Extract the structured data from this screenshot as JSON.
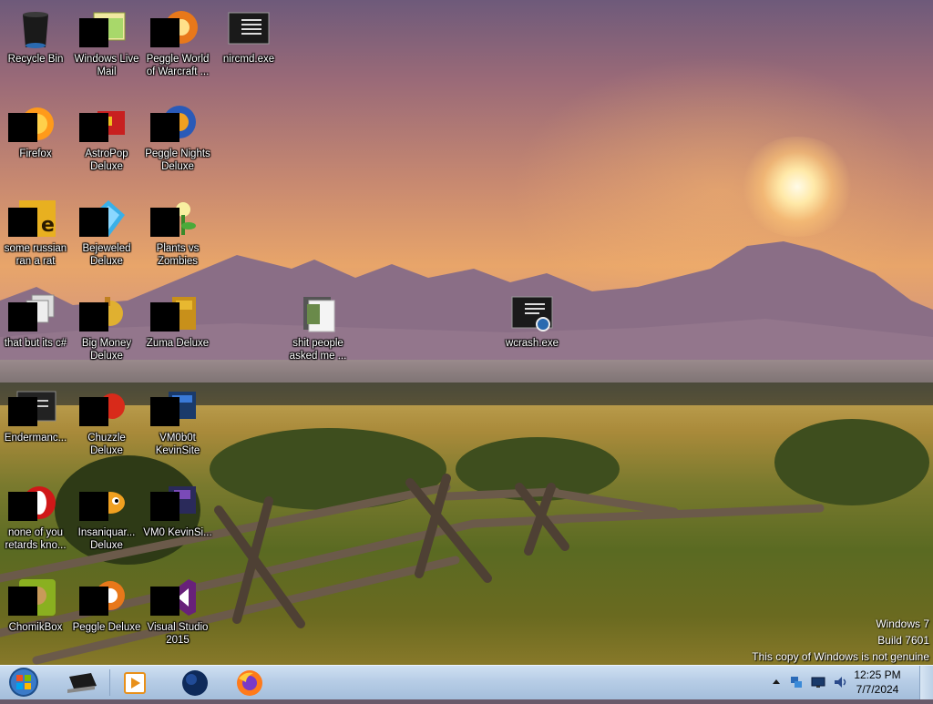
{
  "desktop": {
    "icons": [
      {
        "label": "Recycle Bin",
        "icon": "recycle-bin-icon"
      },
      {
        "label": "Windows Live Mail",
        "icon": "mail-icon"
      },
      {
        "label": "Peggle World of Warcraft ...",
        "icon": "peggle-icon"
      },
      {
        "label": "nircmd.exe",
        "icon": "console-app-icon"
      },
      {
        "label": "Firefox",
        "icon": "firefox-icon"
      },
      {
        "label": "AstroPop Deluxe",
        "icon": "astropop-icon"
      },
      {
        "label": "Peggle Nights Deluxe",
        "icon": "peggle-nights-icon"
      },
      {
        "label": "some russian ran a rat",
        "icon": "adobe-icon"
      },
      {
        "label": "Bejeweled Deluxe",
        "icon": "bejeweled-icon"
      },
      {
        "label": "Plants vs Zombies",
        "icon": "plants-vs-zombies-icon"
      },
      {
        "label": "that but its c#",
        "icon": "stacked-windows-icon"
      },
      {
        "label": "Big Money Deluxe",
        "icon": "big-money-icon"
      },
      {
        "label": "Zuma Deluxe",
        "icon": "zuma-icon"
      },
      {
        "label": "shit people asked me ...",
        "icon": "folder-icon"
      },
      {
        "label": "wcrash.exe",
        "icon": "console-search-icon"
      },
      {
        "label": "Endermanc...",
        "icon": "console-app-icon"
      },
      {
        "label": "Chuzzle Deluxe",
        "icon": "chuzzle-icon"
      },
      {
        "label": "VM0b0t KevinSite",
        "icon": "vm-icon"
      },
      {
        "label": "none of you retards kno...",
        "icon": "opera-icon"
      },
      {
        "label": "Insaniquar... Deluxe",
        "icon": "insaniquarium-icon"
      },
      {
        "label": "VM0 KevinSi...",
        "icon": "vm-icon"
      },
      {
        "label": "ChomikBox",
        "icon": "chomikbox-icon"
      },
      {
        "label": "Peggle Deluxe",
        "icon": "peggle-icon"
      },
      {
        "label": "Visual Studio 2015",
        "icon": "visual-studio-icon"
      }
    ]
  },
  "watermark": {
    "line1": "Windows 7",
    "line2": "Build 7601",
    "line3": "This copy of Windows is not genuine"
  },
  "taskbar": {
    "pinned": [
      {
        "name": "cmd-window-icon"
      },
      {
        "name": "media-player-icon"
      },
      {
        "name": "globe-browser-icon"
      },
      {
        "name": "firefox-icon"
      }
    ],
    "tray": [
      "show-hidden-icons",
      "network-icon",
      "monitor-icon",
      "volume-icon"
    ],
    "clock": {
      "time": "12:25 PM",
      "date": "7/7/2024"
    }
  }
}
